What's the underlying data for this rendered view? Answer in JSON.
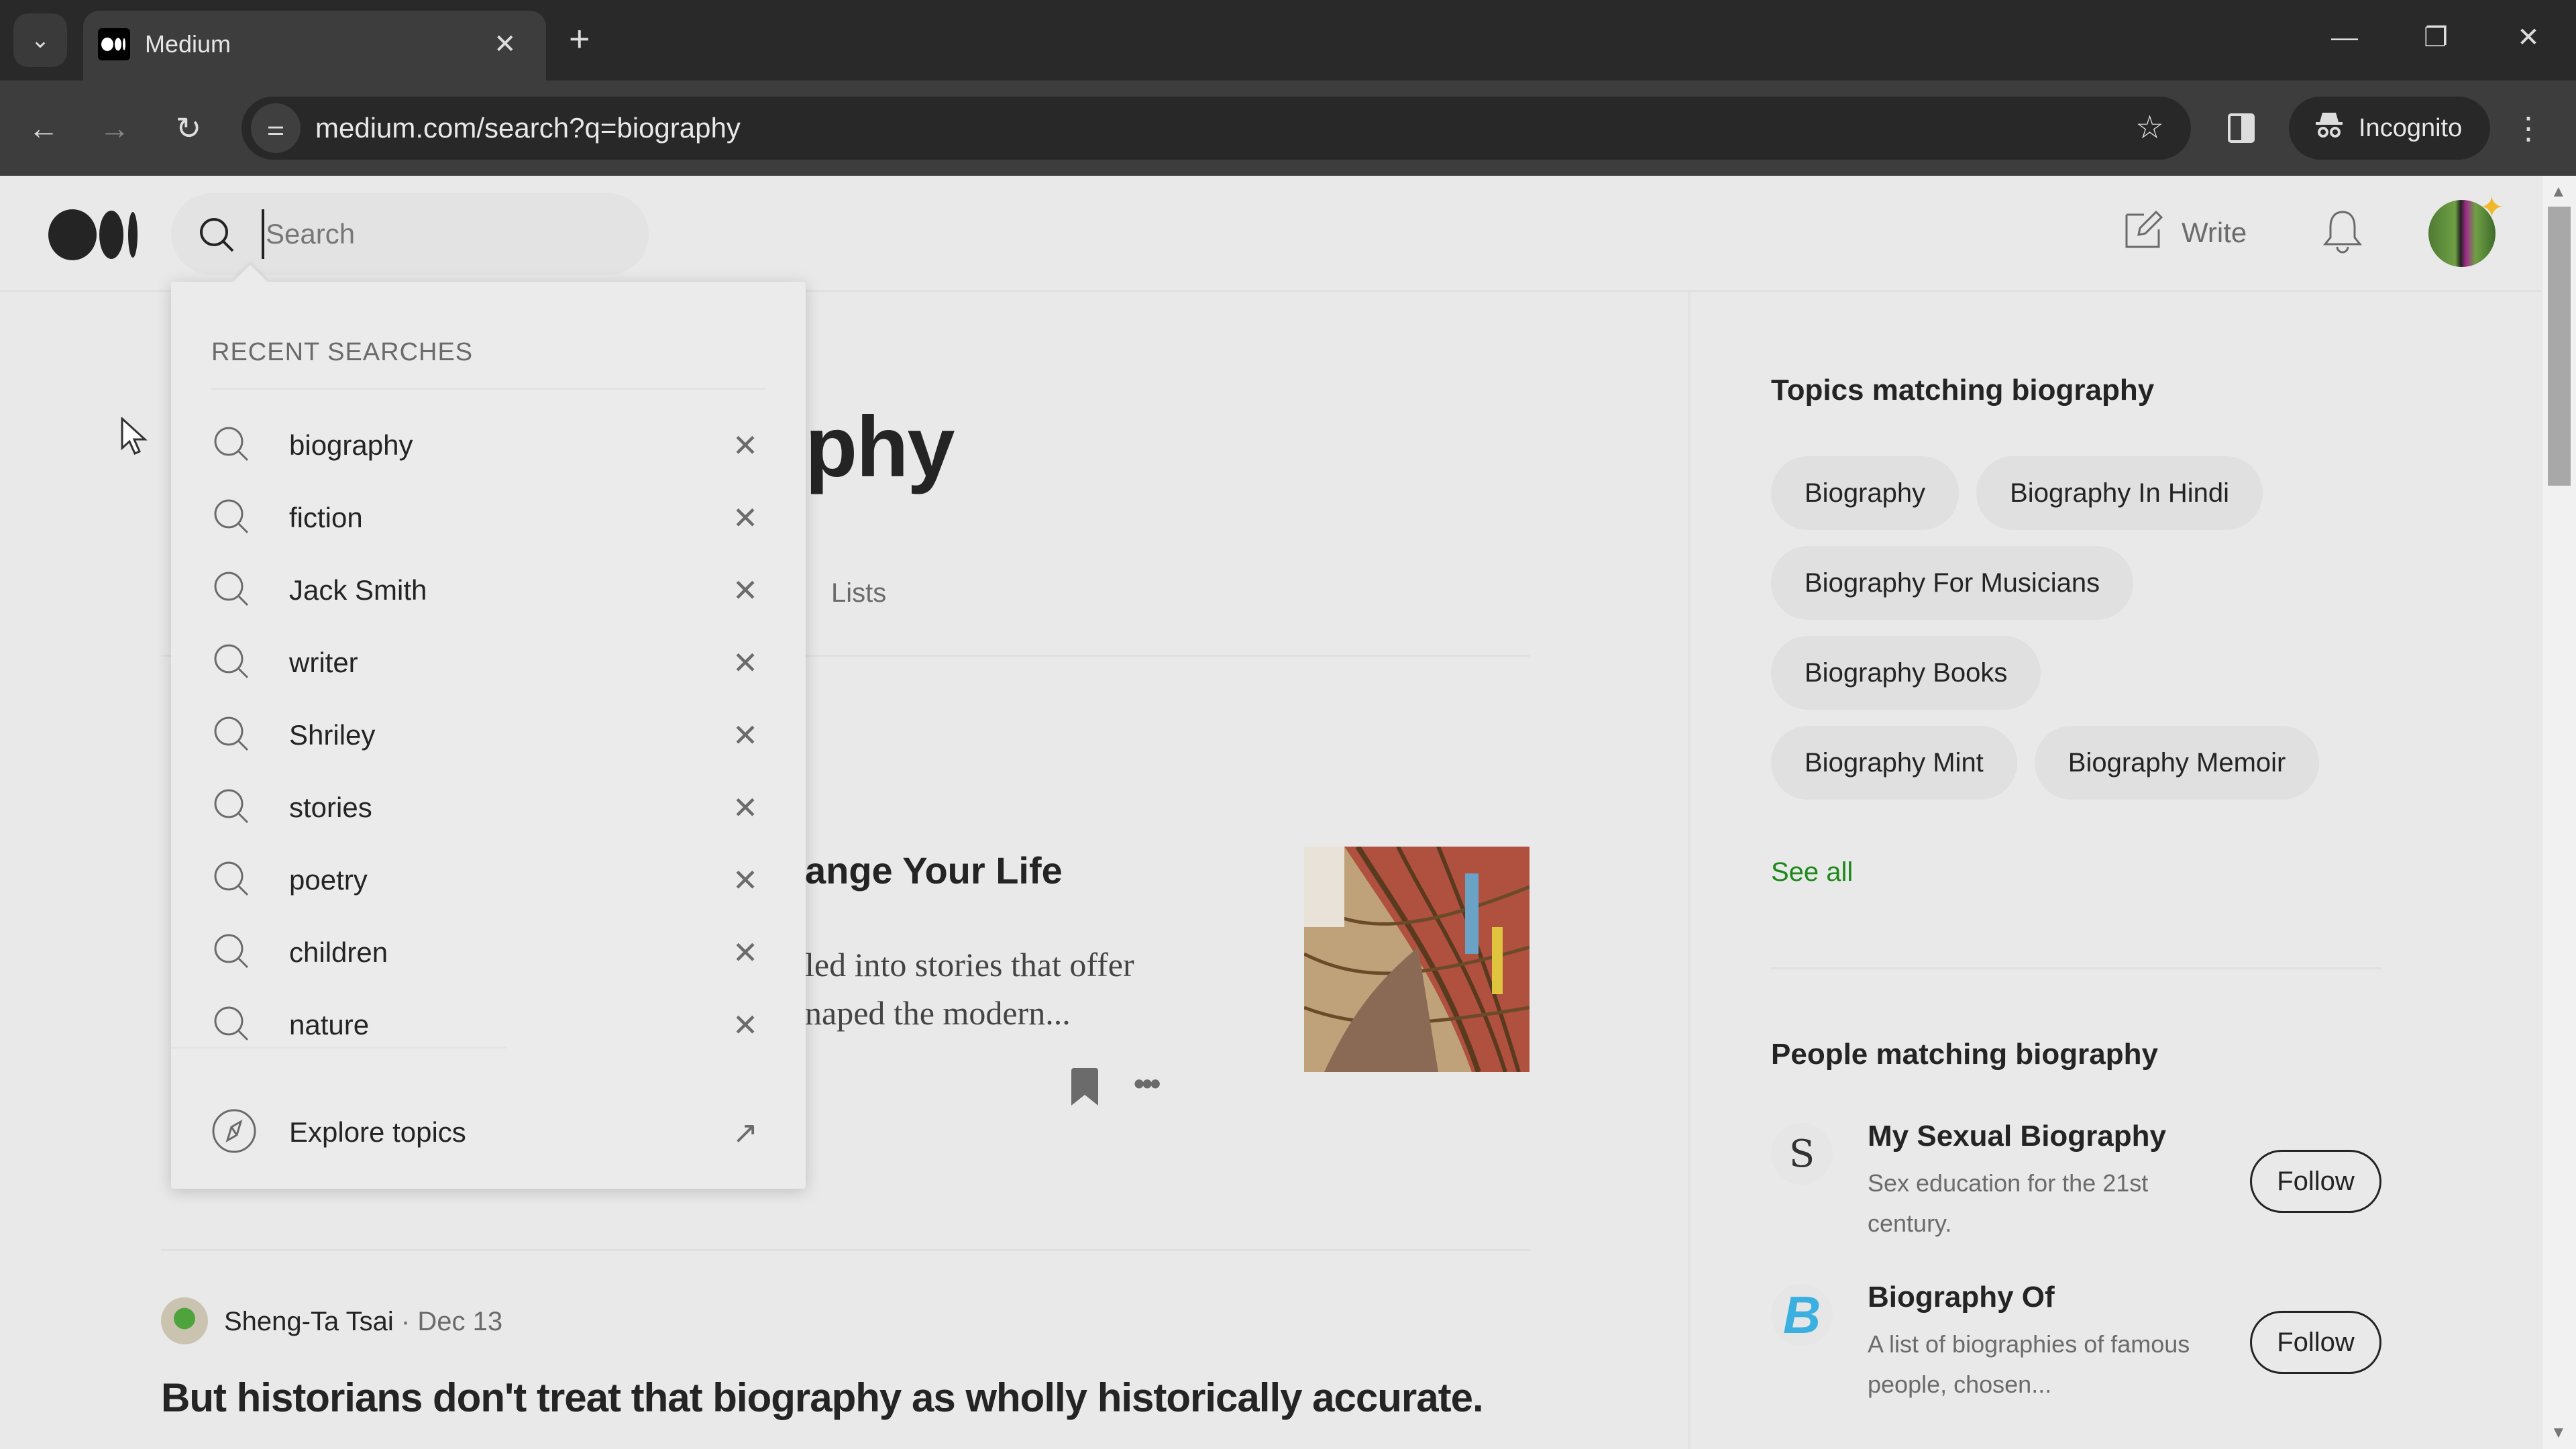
{
  "browser": {
    "tab_title": "Medium",
    "url": "medium.com/search?q=biography",
    "incognito_label": "Incognito",
    "icons": {
      "tab_list": "chevron-down-icon",
      "tab_close": "close-icon",
      "new_tab": "plus-icon",
      "minimize": "minimize-icon",
      "restore": "restore-icon",
      "close_window": "close-icon",
      "back": "arrow-left-icon",
      "forward": "arrow-right-icon",
      "reload": "reload-icon",
      "site_info": "tune-icon",
      "bookmark": "star-icon",
      "side_panel": "side-panel-icon",
      "incognito": "incognito-icon",
      "menu": "kebab-menu-icon"
    }
  },
  "header": {
    "search_placeholder": "Search",
    "search_value": "",
    "write_label": "Write"
  },
  "main": {
    "results_title_visible": "phy",
    "results_title_full_hint": "Results for biography",
    "tabs_visible": [
      "Lists"
    ],
    "article1": {
      "title_visible": "ange Your Life",
      "snippet_line1_visible": "led into stories that offer",
      "snippet_line2_visible": "naped the modern..."
    },
    "article2": {
      "author": "Sheng-Ta Tsai",
      "separator": "·",
      "date": "Dec 13",
      "title": "But historians don't treat that biography as wholly historically accurate."
    }
  },
  "dropdown": {
    "heading": "RECENT SEARCHES",
    "recent_searches": [
      "biography",
      "fiction",
      "Jack Smith",
      "writer",
      "Shriley",
      "stories",
      "poetry",
      "children",
      "nature"
    ],
    "explore_label": "Explore topics"
  },
  "sidebar": {
    "topics_heading": "Topics matching biography",
    "topics": [
      "Biography",
      "Biography In Hindi",
      "Biography For Musicians",
      "Biography Books",
      "Biography Mint",
      "Biography Memoir"
    ],
    "see_all_label": "See all",
    "people_heading": "People matching biography",
    "people": [
      {
        "name": "My Sexual Biography",
        "description": "Sex education for the 21st century.",
        "follow_label": "Follow"
      },
      {
        "name": "Biography Of",
        "description": "A list of biographies of famous people, chosen...",
        "follow_label": "Follow"
      }
    ]
  },
  "colors": {
    "accent_green": "#1a8917",
    "text_primary": "#242424",
    "text_secondary": "#6b6b6b",
    "page_bg": "#e9e9e9",
    "chrome_dark": "#292929"
  }
}
